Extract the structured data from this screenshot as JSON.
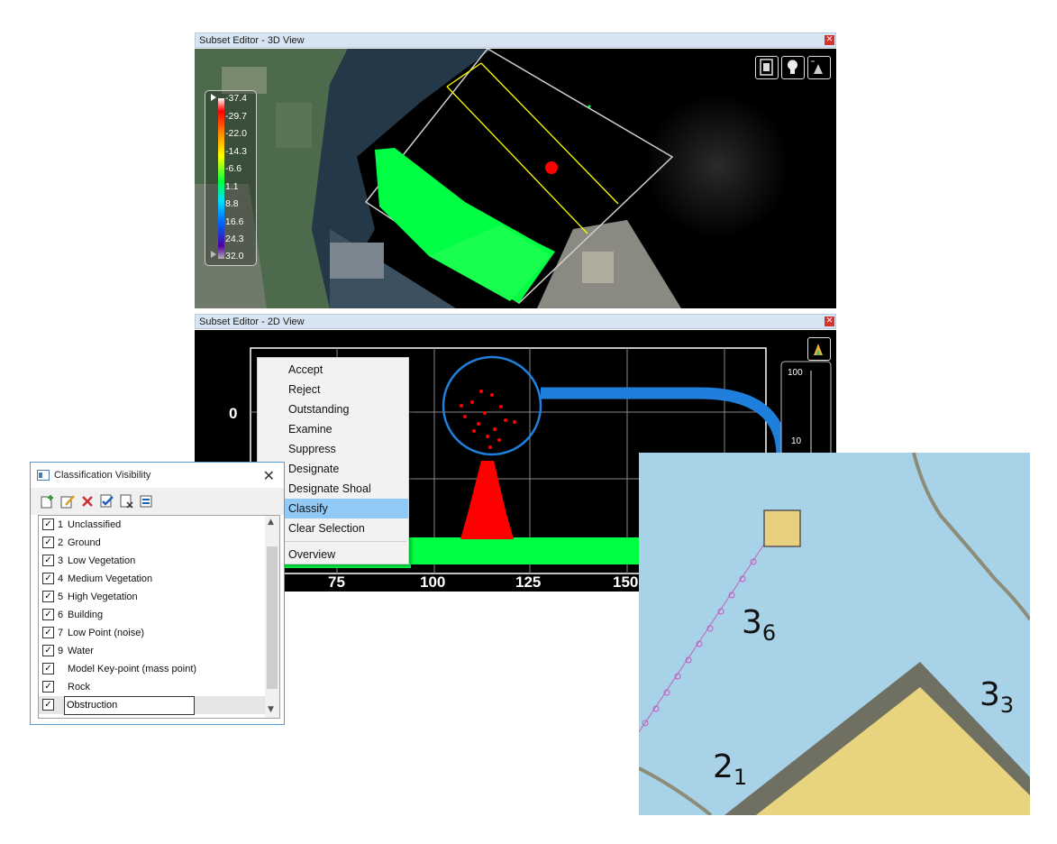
{
  "view3d": {
    "title": "Subset Editor - 3D View",
    "close_icon": "close-icon",
    "toolbar_icons": [
      "film-icon",
      "lightbulb-icon",
      "histogram-icon"
    ],
    "legend_ticks": [
      "-37.4",
      "-29.7",
      "-22.0",
      "-14.3",
      "-6.6",
      "1.1",
      "8.8",
      "16.6",
      "24.3",
      "32.0"
    ],
    "colors": {
      "points": "#00ff44",
      "selection": "#ff0000",
      "profile_lines": "#ffff00"
    }
  },
  "view2d": {
    "title": "Subset Editor - 2D View",
    "close_icon": "close-icon",
    "y_tick": "0",
    "x_ticks": [
      "75",
      "100",
      "125",
      "150"
    ],
    "side_scale": [
      "100",
      "10"
    ],
    "histogram_icon": "histogram-icon"
  },
  "context_menu": {
    "items": [
      "Accept",
      "Reject",
      "Outstanding",
      "Examine",
      "Suppress",
      "Designate",
      "Designate Shoal",
      "Classify",
      "Clear Selection"
    ],
    "highlighted": "Classify",
    "after_separator": "Overview"
  },
  "classification_dialog": {
    "title": "Classification Visibility",
    "toolbar_icons": [
      "add-class-icon",
      "edit-class-icon",
      "delete-class-icon",
      "check-all-icon",
      "uncheck-all-icon",
      "properties-icon"
    ],
    "classes": [
      {
        "code": "1",
        "name": "Unclassified",
        "checked": true
      },
      {
        "code": "2",
        "name": "Ground",
        "checked": true
      },
      {
        "code": "3",
        "name": "Low Vegetation",
        "checked": true
      },
      {
        "code": "4",
        "name": "Medium Vegetation",
        "checked": true
      },
      {
        "code": "5",
        "name": "High Vegetation",
        "checked": true
      },
      {
        "code": "6",
        "name": "Building",
        "checked": true
      },
      {
        "code": "7",
        "name": "Low Point (noise)",
        "checked": true
      },
      {
        "code": "9",
        "name": "Water",
        "checked": true
      },
      {
        "code": "",
        "name": "Model Key-point (mass point)",
        "checked": true
      },
      {
        "code": "",
        "name": "Rock",
        "checked": true
      },
      {
        "code": "",
        "name": "Obstruction",
        "checked": true
      }
    ],
    "editing_value": "Obstruction"
  },
  "chart_inset": {
    "soundings": [
      {
        "depth": "3",
        "sub": "6"
      },
      {
        "depth": "3",
        "sub": "3"
      },
      {
        "depth": "2",
        "sub": "1"
      }
    ],
    "colors": {
      "water": "#a8d2e8",
      "land": "#e8d47e",
      "coast": "#787868",
      "obstruction": "#e8d080",
      "callout_arrow": "#1f7fdc"
    }
  }
}
